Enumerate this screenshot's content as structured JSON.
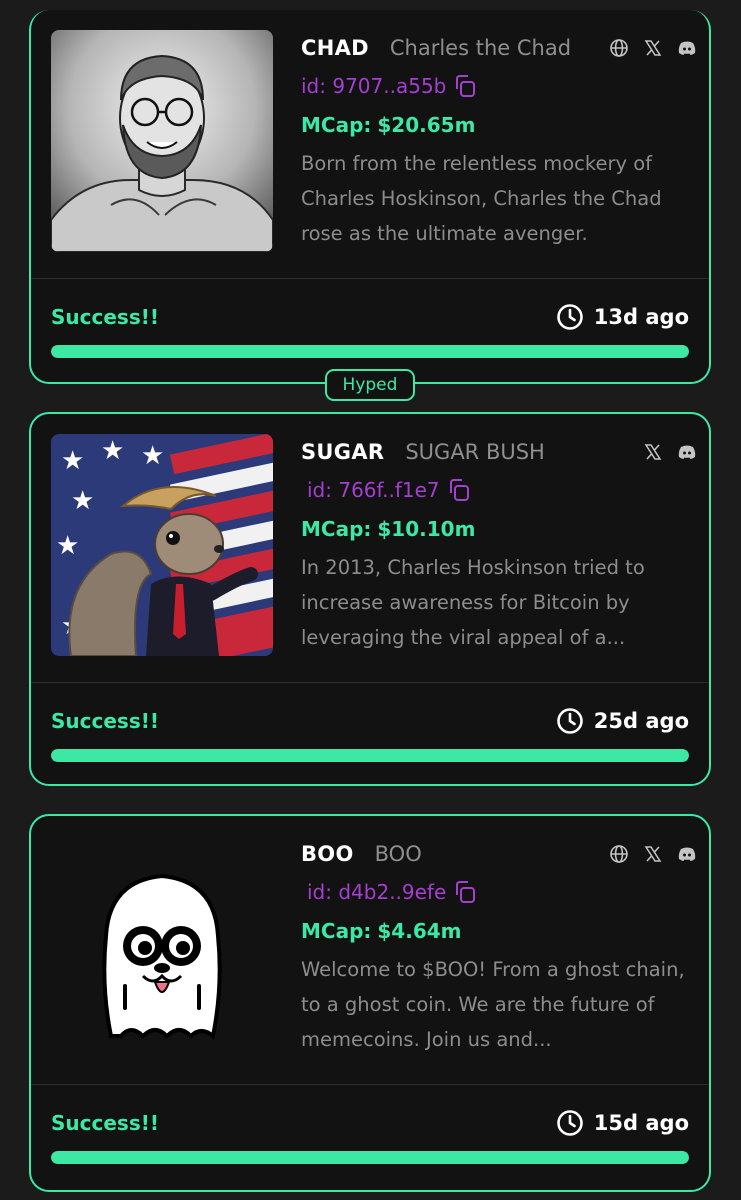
{
  "colors": {
    "accent": "#3de8a5",
    "id_purple": "#a43fd0",
    "card_bg": "#121212",
    "page_bg": "#1b1b1b"
  },
  "hyped_label": "Hyped",
  "cards": [
    {
      "ticker": "CHAD",
      "name": "Charles the Chad",
      "id": "id: 9707..a55b",
      "mcap_label": "MCap:",
      "mcap_value": "$20.65m",
      "description": "Born from the relentless mockery of Charles Hoskinson, Charles the Chad rose as the ultimate avenger.",
      "status": "Success!!",
      "age": "13d ago",
      "progress": 1.0,
      "socials": [
        "globe-icon",
        "x-icon",
        "discord-icon"
      ]
    },
    {
      "ticker": "SUGAR",
      "name": "SUGAR BUSH",
      "id": "id: 766f..f1e7",
      "mcap_label": "MCap:",
      "mcap_value": "$10.10m",
      "description": "In 2013, Charles Hoskinson tried to increase awareness for Bitcoin by leveraging the viral appeal of a...",
      "status": "Success!!",
      "age": "25d ago",
      "progress": 1.0,
      "socials": [
        "x-icon",
        "discord-icon"
      ]
    },
    {
      "ticker": "BOO",
      "name": "BOO",
      "id": "id: d4b2..9efe",
      "mcap_label": "MCap:",
      "mcap_value": "$4.64m",
      "description": "Welcome to $BOO! From a ghost chain, to a ghost coin. We are the future of memecoins. Join us and...",
      "status": "Success!!",
      "age": "15d ago",
      "progress": 1.0,
      "socials": [
        "globe-icon",
        "x-icon",
        "discord-icon"
      ]
    }
  ]
}
